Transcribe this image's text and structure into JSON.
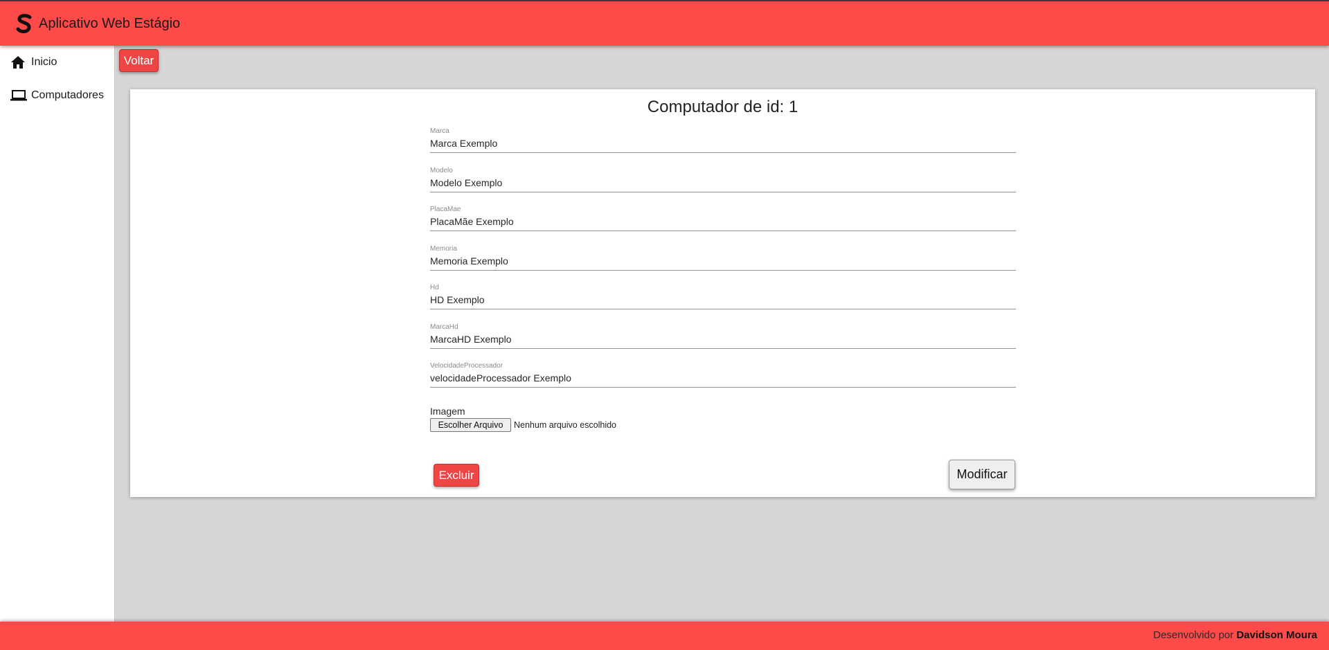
{
  "header": {
    "app_title": "Aplicativo Web Estágio",
    "brand_color": "#ff4a4a"
  },
  "sidebar": {
    "items": [
      {
        "label": "Inicio",
        "icon": "home-icon"
      },
      {
        "label": "Computadores",
        "icon": "laptop-icon"
      }
    ]
  },
  "actions": {
    "back_label": "Voltar"
  },
  "card": {
    "title": "Computador de id: 1",
    "fields": [
      {
        "label": "Marca",
        "value": "Marca Exemplo"
      },
      {
        "label": "Modelo",
        "value": "Modelo Exemplo"
      },
      {
        "label": "PlacaMae",
        "value": "PlacaMãe Exemplo"
      },
      {
        "label": "Memoria",
        "value": "Memoria Exemplo"
      },
      {
        "label": "Hd",
        "value": "HD Exemplo"
      },
      {
        "label": "MarcaHd",
        "value": "MarcaHD Exemplo"
      },
      {
        "label": "VelocidadeProcessador",
        "value": "velocidadeProcessador Exemplo"
      }
    ],
    "image_label": "Imagem",
    "file_button_label": "Escolher Arquivo",
    "file_status": "Nenhum arquivo escolhido",
    "delete_label": "Excluir",
    "modify_label": "Modificar"
  },
  "footer": {
    "prefix": "Desenvolvido por ",
    "author": "Davidson Moura"
  }
}
